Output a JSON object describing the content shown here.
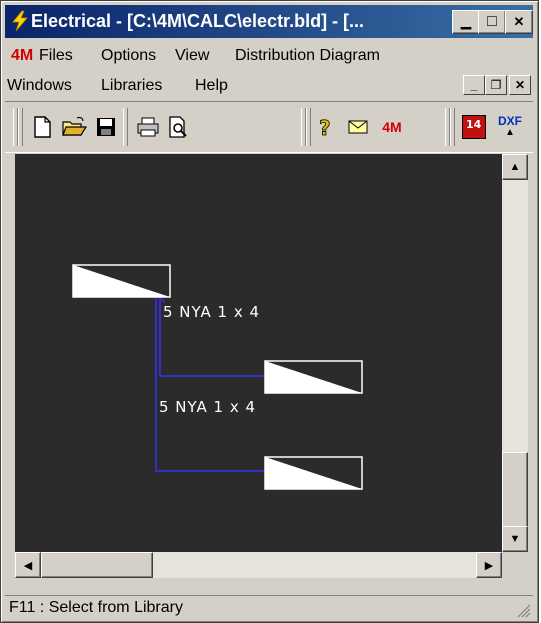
{
  "window": {
    "title": "Electrical - [C:\\4M\\CALC\\electr.bld] - [...",
    "minimize_glyph": "▁",
    "maximize_glyph": "□",
    "close_glyph": "✕"
  },
  "menu_row1": {
    "logo": "4M",
    "items": [
      "Files",
      "Options",
      "View",
      "Distribution Diagram"
    ]
  },
  "menu_row2": {
    "items": [
      "Windows",
      "Libraries",
      "Help"
    ]
  },
  "mdi_controls": {
    "minimize_glyph": "_",
    "restore_glyph": "❐",
    "close_glyph": "✕"
  },
  "toolbar": {
    "icons": [
      "new-document-icon",
      "open-folder-icon",
      "save-disk-icon",
      "print-icon",
      "print-preview-icon",
      "help-icon",
      "mail-icon",
      "4m-logo-icon",
      "calendar-14-icon",
      "dxf-export-icon"
    ],
    "logo_label": "4M",
    "calendar_label": "14",
    "dxf_label": "DXF"
  },
  "diagram": {
    "cable_labels": [
      "5 NYA 1 x 4",
      "5 NYA 1 x 4"
    ],
    "colors": {
      "background": "#2b2b2b",
      "wire": "#3030c8",
      "node": "#ffffff"
    }
  },
  "status": {
    "text": "F11 : Select from Library"
  }
}
